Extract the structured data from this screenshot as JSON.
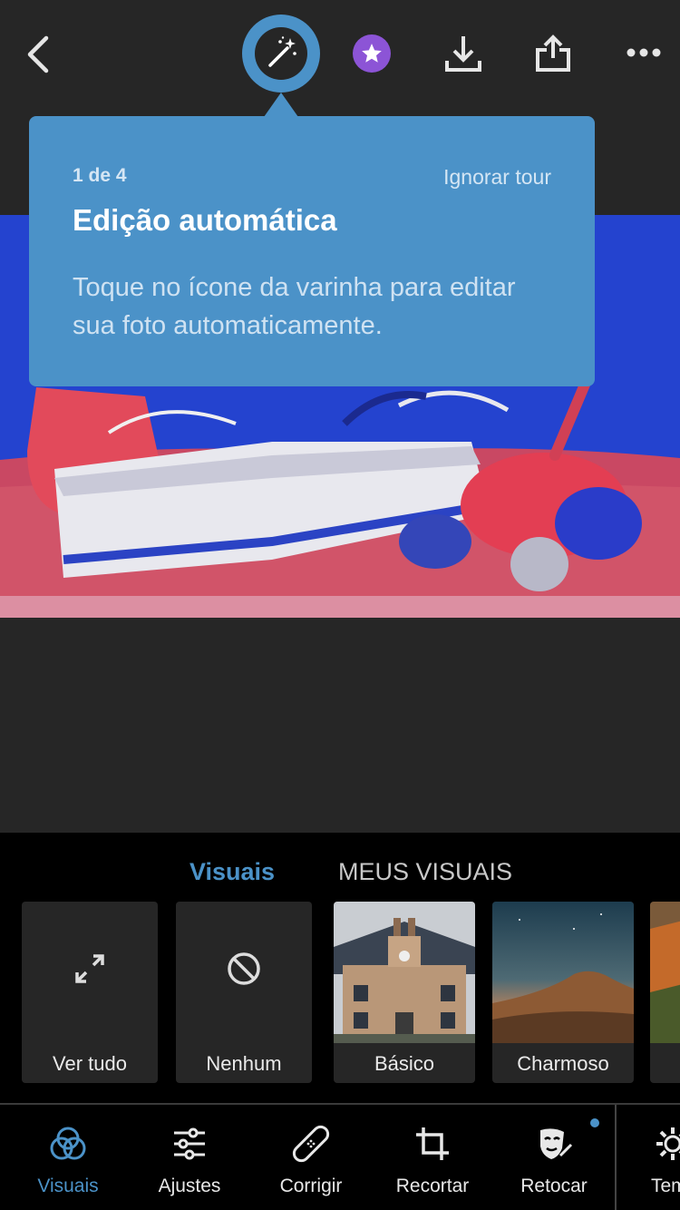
{
  "topbar": {
    "icons": [
      "back-icon",
      "magic-wand-icon",
      "star-icon",
      "download-icon",
      "share-icon",
      "more-icon"
    ],
    "accent": "#4b92c8",
    "star_color": "#8c54d6"
  },
  "tooltip": {
    "step": "1 de 4",
    "skip": "Ignorar tour",
    "title": "Edição automática",
    "body": "Toque no ícone da varinha para editar sua foto automaticamente."
  },
  "looks": {
    "tabs": [
      "Visuais",
      "MEUS VISUAIS"
    ],
    "active_tab": "Visuais",
    "items": [
      {
        "label": "Ver tudo",
        "icon": "expand-icon"
      },
      {
        "label": "Nenhum",
        "icon": "none-icon"
      },
      {
        "label": "Básico",
        "thumb": "house-photo"
      },
      {
        "label": "Charmoso",
        "thumb": "hills-photo"
      }
    ]
  },
  "toolbar": {
    "items": [
      {
        "label": "Visuais",
        "icon": "looks-icon",
        "active": true
      },
      {
        "label": "Ajustes",
        "icon": "sliders-icon"
      },
      {
        "label": "Corrigir",
        "icon": "bandage-icon"
      },
      {
        "label": "Recortar",
        "icon": "crop-icon"
      },
      {
        "label": "Retocar",
        "icon": "face-retouch-icon"
      },
      {
        "label": "Tem",
        "icon": "gear-icon"
      }
    ]
  }
}
